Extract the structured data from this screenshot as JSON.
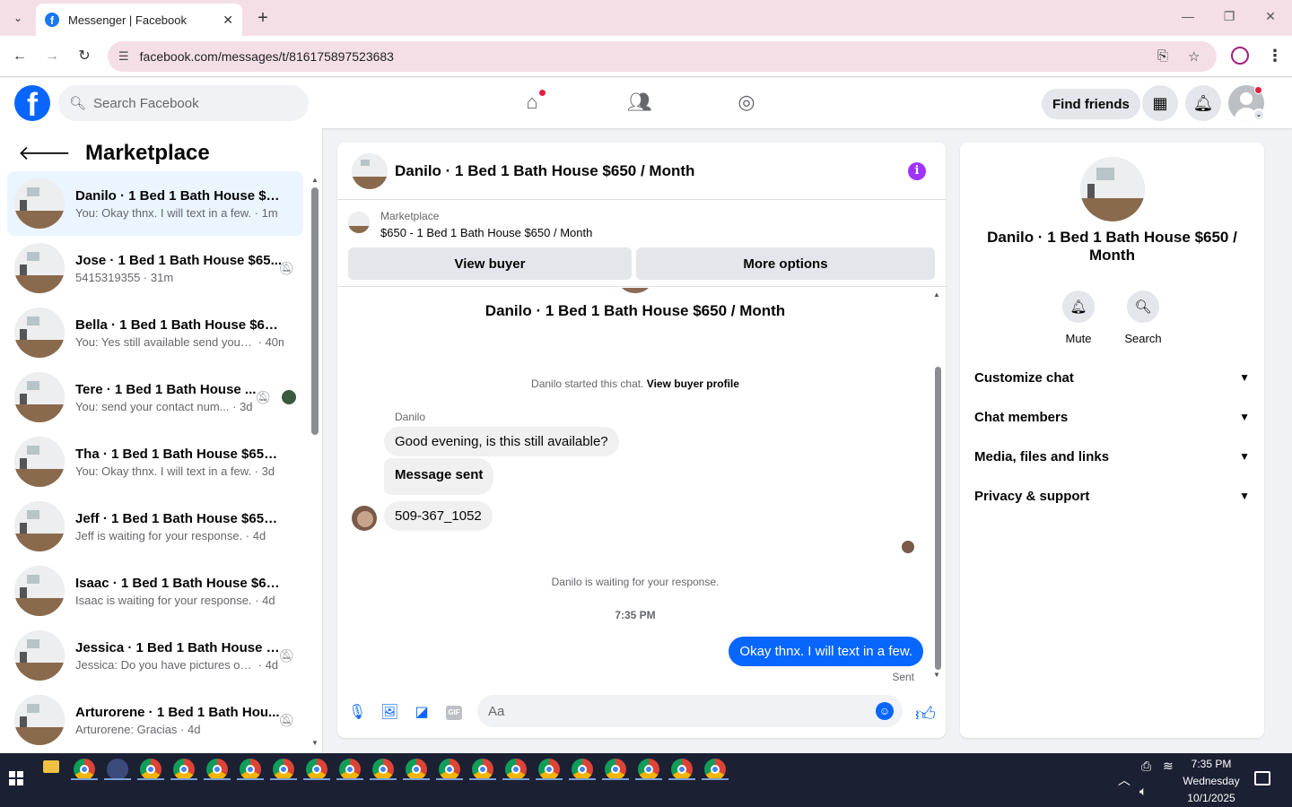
{
  "browser": {
    "tab_title": "Messenger | Facebook",
    "url": "facebook.com/messages/t/816175897523683"
  },
  "fb_nav": {
    "search_placeholder": "Search Facebook",
    "find_friends": "Find friends"
  },
  "sidebar": {
    "title": "Marketplace",
    "conversations": [
      {
        "name": "Danilo · 1 Bed 1 Bath House $65...",
        "preview": "You: Okay thnx. I will text in a few.",
        "time": "1m",
        "active": true
      },
      {
        "name": "Jose · 1 Bed 1 Bath House $65...",
        "preview": "5415319355",
        "time": "31m",
        "muted": true
      },
      {
        "name": "Bella · 1 Bed 1 Bath House $650 ...",
        "preview": "You: Yes still available send your c...",
        "time": "40m"
      },
      {
        "name": "Tere · 1 Bed 1 Bath House ...",
        "preview": "You: send your contact num...",
        "time": "3d",
        "muted": true,
        "seen": true
      },
      {
        "name": "Tha · 1 Bed 1 Bath House $650 / ...",
        "preview": "You: Okay thnx. I will text in a few.",
        "time": "3d"
      },
      {
        "name": "Jeff · 1 Bed 1 Bath House $650 / ...",
        "preview": "Jeff is waiting for your response.",
        "time": "4d"
      },
      {
        "name": "Isaac · 1 Bed 1 Bath House $650 ...",
        "preview": "Isaac is waiting for your response.",
        "time": "4d"
      },
      {
        "name": "Jessica · 1 Bed 1 Bath House $...",
        "preview": "Jessica: Do you have pictures of ...",
        "time": "4d",
        "muted": true
      },
      {
        "name": "Arturorene · 1 Bed 1 Bath Hou...",
        "preview": "Arturorene: Gracias",
        "time": "4d",
        "muted": true
      }
    ]
  },
  "chat": {
    "title": "Danilo · 1 Bed 1 Bath House $650 / Month",
    "marketplace_label": "Marketplace",
    "listing": "$650 - 1 Bed 1 Bath House $650 / Month",
    "view_buyer": "View buyer",
    "more_options": "More options",
    "big_name": "Danilo · 1 Bed 1 Bath House $650 / Month",
    "started_text": "Danilo started this chat.",
    "view_profile": "View buyer profile",
    "sender": "Danilo",
    "messages": [
      "Good evening, is this still available?",
      "Message sent",
      "509-367_1052"
    ],
    "waiting": "Danilo is waiting for your response.",
    "timestamp": "7:35 PM",
    "my_message": "Okay thnx. I will text in a few.",
    "sent": "Sent",
    "input_placeholder": "Aa"
  },
  "info_panel": {
    "name": "Danilo · 1 Bed 1 Bath House $650 / Month",
    "mute": "Mute",
    "search": "Search",
    "sections": [
      "Customize chat",
      "Chat members",
      "Media, files and links",
      "Privacy & support"
    ]
  },
  "taskbar": {
    "time": "7:35 PM",
    "day": "Wednesday",
    "date": "10/1/2025"
  },
  "colors": {
    "accent": "#0866ff",
    "info_icon": "#a033ff",
    "active_row": "#ebf5ff"
  }
}
